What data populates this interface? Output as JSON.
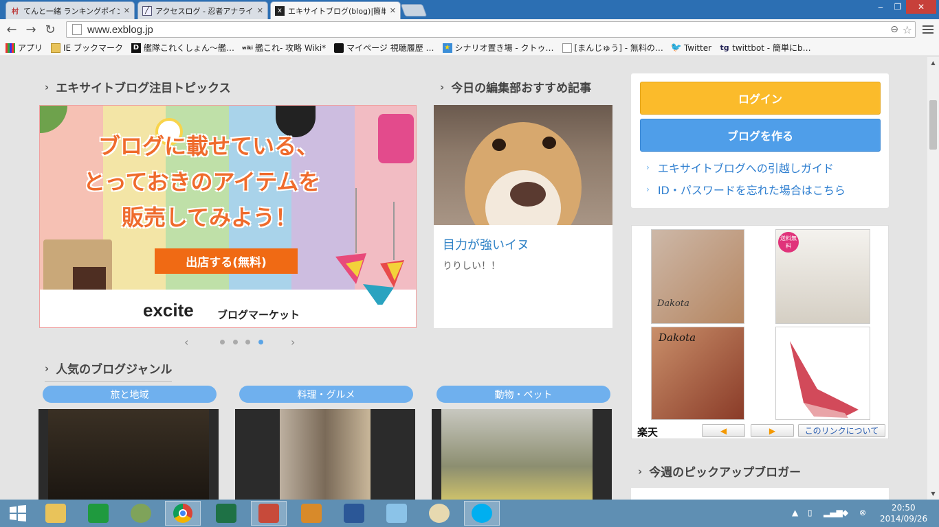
{
  "browser": {
    "tabs": [
      {
        "label": "てんと一緒 ランキングポイント",
        "favicon": "村",
        "active": false
      },
      {
        "label": "アクセスログ - 忍者アナライズ",
        "favicon": "📈",
        "active": false
      },
      {
        "label": "エキサイトブログ(blog)|簡単",
        "favicon": "x",
        "active": true
      }
    ],
    "url": "www.exblog.jp",
    "window_controls": {
      "min": "‒",
      "max": "❐",
      "close": "✕"
    }
  },
  "bookmarks": [
    {
      "label": "アプリ",
      "icon": "apps-grid-icon"
    },
    {
      "label": "IE ブックマーク",
      "icon": "folder-icon"
    },
    {
      "label": "艦隊これくしょん～艦…",
      "icon": "D"
    },
    {
      "label": "艦これ- 攻略 Wiki*",
      "icon": "wiki"
    },
    {
      "label": "マイページ 視聴履歴 …",
      "icon": "tv"
    },
    {
      "label": "シナリオ置き場 - クトゥ…",
      "icon": "★"
    },
    {
      "label": "[まんじゅう] - 無料の…",
      "icon": "page"
    },
    {
      "label": "Twitter",
      "icon": "twitter-bird"
    },
    {
      "label": "twittbot - 簡単にb…",
      "icon": "tg"
    }
  ],
  "page": {
    "topics_heading": "エキサイトブログ注目トピックス",
    "pick_heading": "今日の編集部おすすめ記事",
    "banner": {
      "line1": "ブログに載せている、",
      "line2": "とっておきのアイテムを",
      "line3": "販売してみよう！",
      "button": "出店する(無料)",
      "logo": "excite",
      "logo_suffix": "ブログマーケット"
    },
    "carousel": {
      "prev": "‹",
      "next": "›",
      "dots": 4,
      "active_dot": 4
    },
    "pick": {
      "title": "目力が強いイヌ",
      "desc": "りりしい！！"
    },
    "genres_heading": "人気のブログジャンル",
    "genres": [
      "旅と地域",
      "料理・グルメ",
      "動物・ペット"
    ],
    "login": {
      "login_label": "ログイン",
      "create_label": "ブログを作る",
      "link1": "エキサイトブログへの引越しガイド",
      "link2": "ID・パスワードを忘れた場合はこちら"
    },
    "ads": {
      "brand1": "Dakota",
      "brand2": "Dakota",
      "badge": "送料無料",
      "rakuten": "楽天",
      "prev": "◀",
      "next": "▶",
      "about": "このリンクについて"
    },
    "pickup_heading": "今週のピックアップブロガー"
  },
  "taskbar": {
    "apps": [
      "windows-start",
      "file-explorer",
      "store",
      "xbox-game",
      "chrome",
      "excel",
      "game-app",
      "media-app",
      "word",
      "notepad",
      "paint",
      "skype"
    ],
    "time": "20:50",
    "date": "2014/09/26"
  },
  "colors": {
    "accent_blue": "#4f9ee9",
    "login_yellow": "#fbbb2b",
    "taskbar": "#5f8fb3",
    "link_blue": "#2f7fd0"
  }
}
